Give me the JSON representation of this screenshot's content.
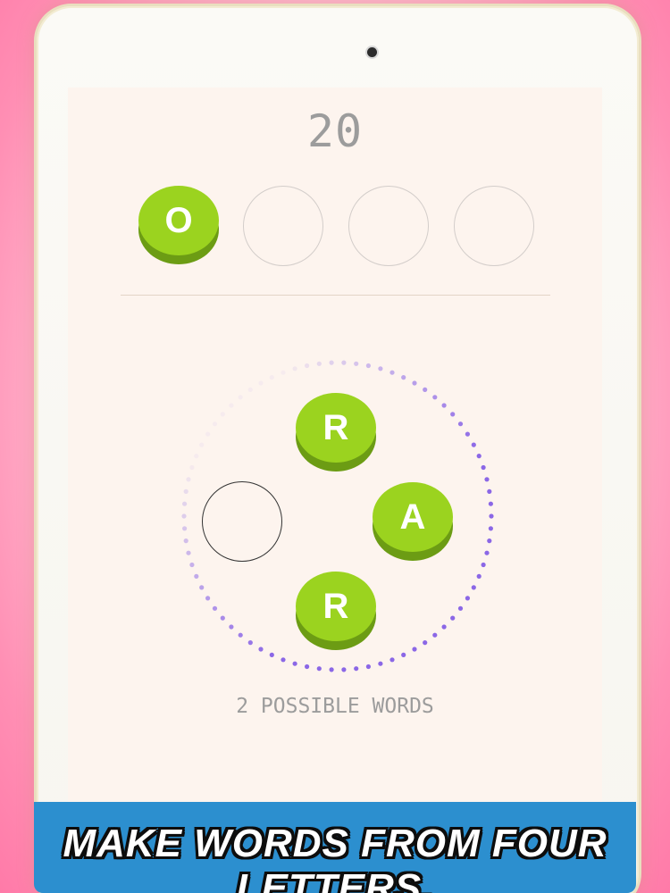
{
  "game": {
    "score": "20",
    "possible_words": "2 POSSIBLE WORDS"
  },
  "answer_slots": [
    {
      "letter": "O",
      "filled": true
    },
    {
      "letter": "",
      "filled": false
    },
    {
      "letter": "",
      "filled": false
    },
    {
      "letter": "",
      "filled": false
    }
  ],
  "wheel_tiles": [
    {
      "letter": "R"
    },
    {
      "letter": "A"
    },
    {
      "letter": "R"
    }
  ],
  "banner": {
    "text": "MAKE WORDS FROM FOUR LETTERS."
  },
  "colors": {
    "tile_face": "#9bd31f",
    "tile_side": "#6c9c14",
    "ring_dot": "#8b67e6",
    "banner": "#2c8fcf"
  }
}
